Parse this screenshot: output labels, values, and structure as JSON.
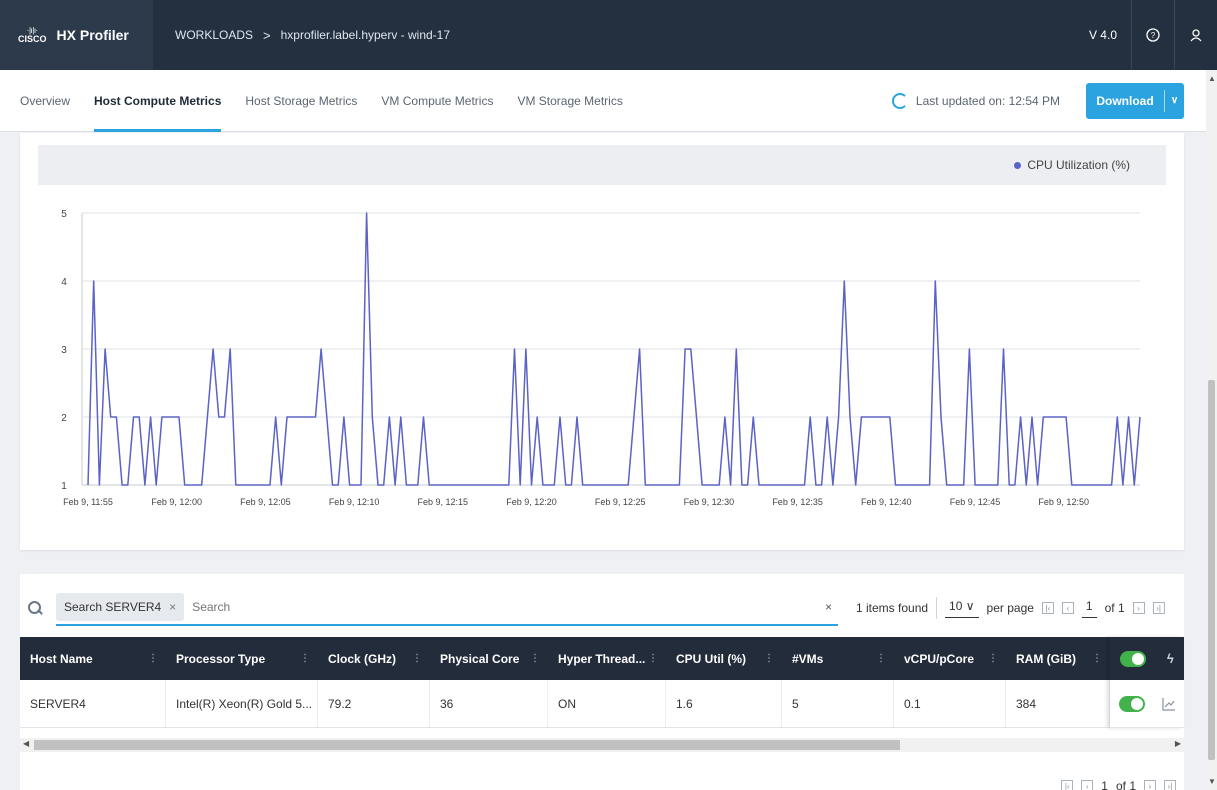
{
  "header": {
    "logo_top": "·|ı|ı·",
    "logo_word": "CISCO",
    "app_name": "HX Profiler",
    "breadcrumb": [
      "WORKLOADS",
      "hxprofiler.label.hyperv - wind-17"
    ],
    "breadcrumb_sep": ">",
    "version": "V 4.0",
    "help_icon": "help-circle-icon",
    "user_icon": "user-icon"
  },
  "tabs": [
    {
      "label": "Overview",
      "active": false
    },
    {
      "label": "Host Compute Metrics",
      "active": true
    },
    {
      "label": "Host Storage Metrics",
      "active": false
    },
    {
      "label": "VM Compute Metrics",
      "active": false
    },
    {
      "label": "VM Storage Metrics",
      "active": false
    }
  ],
  "status": {
    "last_updated": "Last updated on: 12:54 PM",
    "download_label": "Download",
    "download_caret": "∨"
  },
  "chart_data": {
    "type": "line",
    "legend": [
      "CPU Utilization (%)"
    ],
    "legend_position": "top-right",
    "ylim": [
      1,
      5
    ],
    "yticks": [
      1,
      2,
      3,
      4,
      5
    ],
    "xtick_labels": [
      "Feb 9, 11:55",
      "Feb 9, 12:00",
      "Feb 9, 12:05",
      "Feb 9, 12:10",
      "Feb 9, 12:15",
      "Feb 9, 12:20",
      "Feb 9, 12:25",
      "Feb 9, 12:30",
      "Feb 9, 12:35",
      "Feb 9, 12:40",
      "Feb 9, 12:45",
      "Feb 9, 12:50"
    ],
    "grid": true,
    "color": "#5b63c6",
    "series": [
      {
        "name": "CPU Utilization (%)",
        "values": [
          1,
          4,
          1,
          3,
          2,
          2,
          1,
          1,
          2,
          2,
          1,
          2,
          1,
          2,
          2,
          2,
          2,
          1,
          1,
          1,
          1,
          2,
          3,
          2,
          2,
          3,
          1,
          1,
          1,
          1,
          1,
          1,
          1,
          2,
          1,
          2,
          2,
          2,
          2,
          2,
          2,
          3,
          2,
          1,
          1,
          2,
          1,
          1,
          1,
          5,
          2,
          1,
          1,
          2,
          1,
          2,
          1,
          1,
          1,
          2,
          1,
          1,
          1,
          1,
          1,
          1,
          1,
          1,
          1,
          1,
          1,
          1,
          1,
          1,
          1,
          3,
          1,
          3,
          1,
          2,
          1,
          1,
          1,
          2,
          1,
          1,
          2,
          1,
          1,
          1,
          1,
          1,
          1,
          1,
          1,
          1,
          2,
          3,
          1,
          1,
          1,
          1,
          1,
          1,
          1,
          3,
          3,
          2,
          1,
          1,
          1,
          1,
          2,
          1,
          3,
          1,
          1,
          2,
          1,
          1,
          1,
          1,
          1,
          1,
          1,
          1,
          1,
          2,
          1,
          1,
          2,
          1,
          2,
          4,
          2,
          1,
          2,
          2,
          2,
          2,
          2,
          2,
          1,
          1,
          1,
          1,
          1,
          1,
          1,
          4,
          2,
          1,
          1,
          1,
          1,
          3,
          1,
          1,
          1,
          1,
          1,
          3,
          1,
          1,
          2,
          1,
          2,
          1,
          2,
          2,
          2,
          2,
          2,
          1,
          1,
          1,
          1,
          1,
          1,
          1,
          1,
          2,
          1,
          2,
          1,
          2
        ],
        "x_start": "Feb 9, 11:55",
        "x_end": "Feb 9, 12:54"
      }
    ]
  },
  "search": {
    "chip_label": "Search SERVER4",
    "chip_close": "×",
    "placeholder": "Search",
    "clear": "×"
  },
  "pager": {
    "items_found": "1 items found",
    "per_page_value": "10",
    "per_page_caret": "∨",
    "per_page_label": "per page",
    "page_current": "1",
    "page_of": "of 1"
  },
  "table": {
    "columns": [
      "Host Name",
      "Processor Type",
      "Clock (GHz)",
      "Physical Core",
      "Hyper Thread...",
      "CPU Util (%)",
      "#VMs",
      "vCPU/pCore",
      "RAM (GiB)"
    ],
    "sort_glyph": "⋮",
    "rows": [
      {
        "host": "SERVER4",
        "processor": "Intel(R) Xeon(R) Gold 5...",
        "clock": "79.2",
        "cores": "36",
        "ht": "ON",
        "cpu": "1.6",
        "vms": "5",
        "vcpu": "0.1",
        "ram": "384"
      }
    ]
  },
  "bottom_pager": {
    "page_current": "1",
    "page_of": "of 1"
  }
}
